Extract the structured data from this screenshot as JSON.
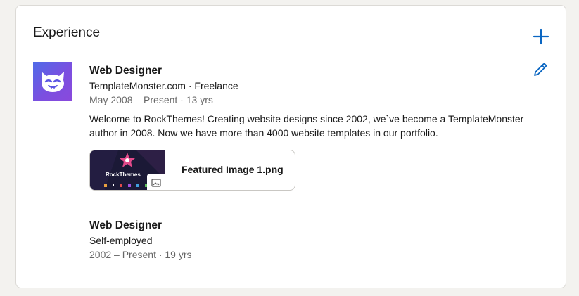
{
  "section": {
    "title": "Experience"
  },
  "colors": {
    "accent": "#0a66c2",
    "logo_gradient_start": "#4f6be8",
    "logo_gradient_end": "#8a49dc"
  },
  "icons": {
    "add": "plus-icon",
    "edit": "pencil-icon",
    "logo": "template-monster-logo",
    "media_type": "image-icon"
  },
  "experiences": [
    {
      "title": "Web Designer",
      "company": "TemplateMonster.com · Freelance",
      "dates": "May 2008 – Present · 13 yrs",
      "description": "Welcome to RockThemes! Creating website designs since 2002, we`ve become a TemplateMonster author in 2008. Now we have more than 4000 website templates in our portfolio.",
      "media": {
        "label": "Featured Image 1.png",
        "thumb_text": "RockThemes"
      }
    },
    {
      "title": "Web Designer",
      "company": "Self-employed",
      "dates": "2002 – Present · 19 yrs"
    }
  ]
}
